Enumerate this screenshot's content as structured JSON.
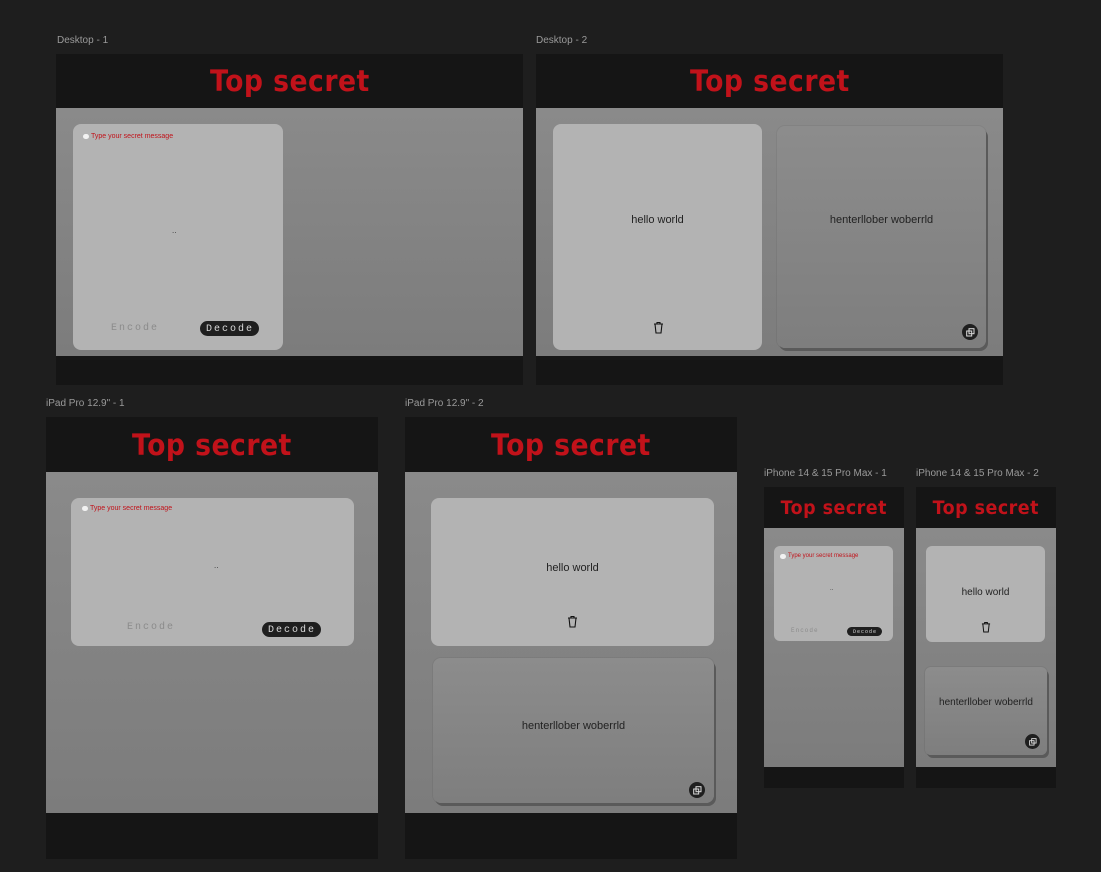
{
  "frames": {
    "desktop1": "Desktop - 1",
    "desktop2": "Desktop - 2",
    "ipad1": "iPad Pro 12.9\" - 1",
    "ipad2": "iPad Pro 12.9\" - 2",
    "iphone1": "iPhone 14 & 15 Pro Max - 1",
    "iphone2": "iPhone 14 & 15 Pro Max - 2"
  },
  "app": {
    "title": "Top secret",
    "placeholder": "Type your secret message",
    "input_value": "..",
    "encode_label": "Encode",
    "decode_label": "Decode",
    "plain_text": "hello world",
    "encoded_text": "henterllober woberrld"
  },
  "icons": {
    "trash": "trash-icon",
    "copy": "copy-icon",
    "message": "message-bubble-icon"
  },
  "colors": {
    "background": "#1e1e1e",
    "frame": "#151515",
    "title": "#c1121a",
    "card": "#b3b3b3",
    "body": "#8a8a8a"
  }
}
